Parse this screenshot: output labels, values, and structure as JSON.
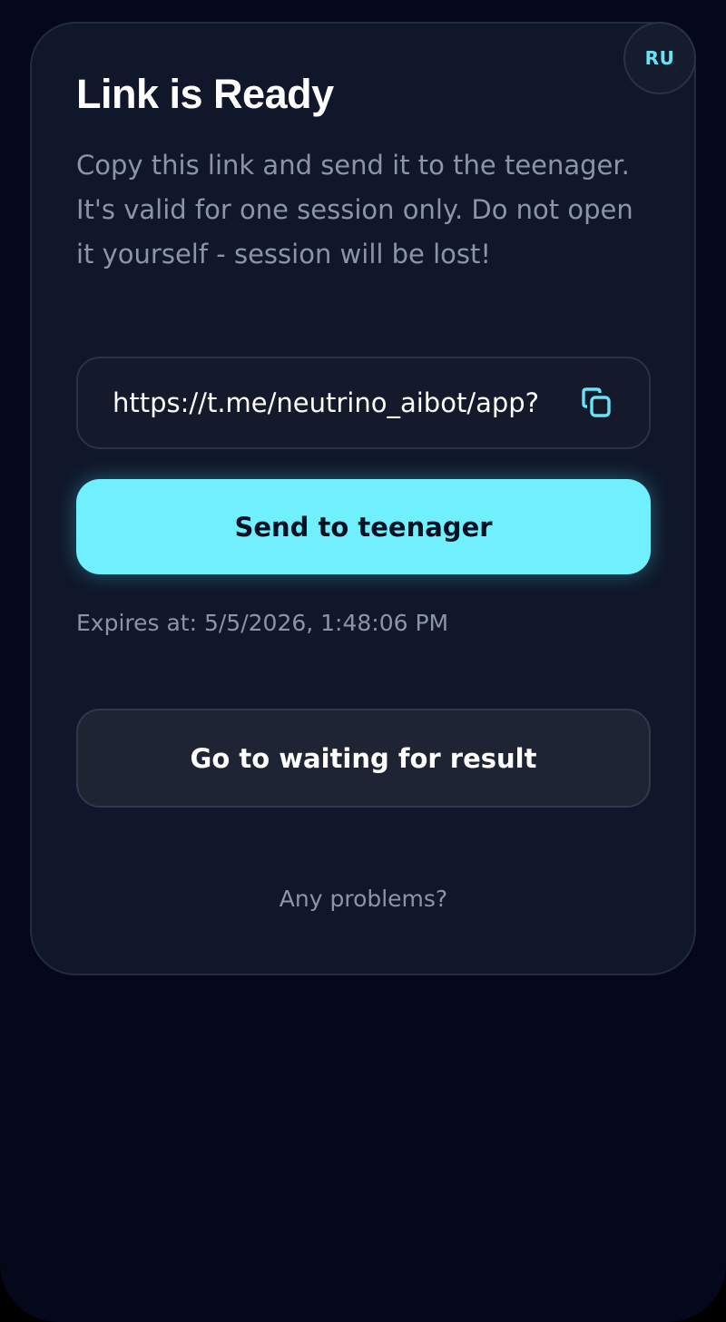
{
  "language_badge": {
    "label": "RU"
  },
  "card": {
    "title": "Link is Ready",
    "description": "Copy this link and send it to the teenager. It's valid for one session only. Do not open it yourself - session will be lost!",
    "link": {
      "value": "https://t.me/neutrino_aibot/app?",
      "copy_icon": "copy-icon"
    },
    "send_button_label": "Send to teenager",
    "expires_text": "Expires at: 5/5/2026, 1:48:06 PM",
    "wait_button_label": "Go to waiting for result",
    "problems_link": "Any problems?"
  },
  "colors": {
    "background": "#04081a",
    "card": "#10172a",
    "accent": "#6ff0fc",
    "badge_text": "#67e3f4",
    "muted_text": "#8c95a6",
    "secondary_button": "#1f2434"
  }
}
